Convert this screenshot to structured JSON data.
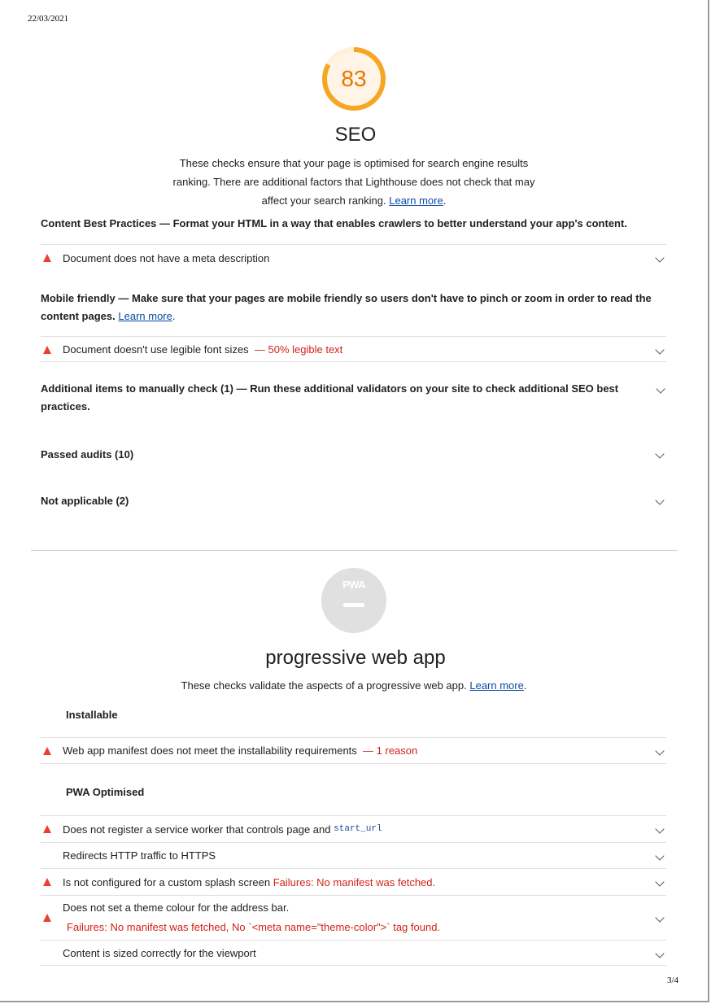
{
  "date": "22/03/2021",
  "page_number": "3/4",
  "seo": {
    "score": "83",
    "score_color": "#e67700",
    "title": "SEO",
    "description": "These checks ensure that your page is optimised for search engine results ranking. There are additional factors that Lighthouse does not check that may affect your search ranking.",
    "learn_more": "Learn more",
    "content_best_practices": {
      "title": "Content Best Practices",
      "dash": "—",
      "description": "Format your HTML in a way that enables crawlers to better understand your app's content."
    },
    "audit_meta_description": "Document does not have a meta description",
    "mobile_friendly": {
      "title": "Mobile friendly",
      "dash": "—",
      "description": "Make sure that your pages are mobile friendly so users don't have to pinch or zoom in order to read the content pages.",
      "learn_more": "Learn more"
    },
    "audit_font_sizes": "Document doesn't use legible font sizes",
    "audit_font_sizes_detail": "— 50% legible text",
    "manual_check": {
      "title": "Additional items to manually check (1)",
      "dash": "—",
      "description": "Run these additional validators on your site to check additional SEO best practices."
    },
    "passed_audits": "Passed audits (10)",
    "not_applicable": "Not applicable (2)"
  },
  "pwa": {
    "badge_text": "PWA",
    "title": "progressive web app",
    "description": "These checks validate the aspects of a progressive web app.",
    "learn_more": "Learn more",
    "installable": "Installable",
    "audit_manifest": "Web app manifest does not meet the installability requirements",
    "audit_manifest_detail": "— 1 reason",
    "pwa_optimised": "PWA Optimised",
    "audit_service_worker": "Does not register a service worker that controls page and",
    "audit_service_worker_code": "start_url",
    "audit_https": "Redirects HTTP traffic to HTTPS",
    "audit_splash": "Is not configured for a custom splash screen",
    "audit_splash_fail": "Failures: No manifest was fetched.",
    "audit_theme": "Does not set a theme colour for the address bar.",
    "audit_theme_fail": "Failures: No manifest was fetched, No `<meta name=\"theme-color\">` tag found.",
    "audit_viewport": "Content is sized correctly for the viewport"
  }
}
